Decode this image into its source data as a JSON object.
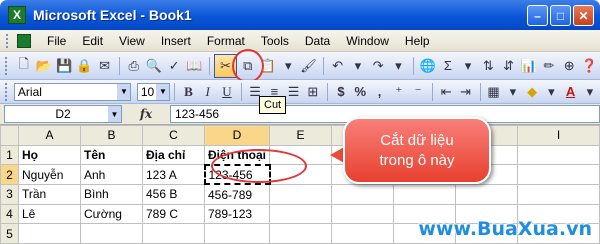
{
  "window": {
    "title": "Microsoft Excel - Book1",
    "app_icon_letter": "X",
    "buttons": {
      "minimize": "–",
      "maximize": "□",
      "close": "✕"
    }
  },
  "menu": {
    "items": [
      "File",
      "Edit",
      "View",
      "Insert",
      "Format",
      "Tools",
      "Data",
      "Window",
      "Help"
    ]
  },
  "toolbar": {
    "standard_icons": [
      "new-icon",
      "open-icon",
      "save-icon",
      "permission-icon",
      "email-icon",
      "print-icon",
      "print-preview-icon",
      "spelling-icon",
      "research-icon",
      "cut-icon",
      "copy-icon",
      "paste-icon",
      "format-painter-icon",
      "undo-icon",
      "redo-icon",
      "hyperlink-icon",
      "autosum-icon",
      "sort-ascending-icon",
      "sort-descending-icon",
      "chart-wizard-icon",
      "drawing-icon",
      "zoom-icon",
      "help-icon"
    ],
    "cut_tooltip": "Cut",
    "font_name": "Arial",
    "font_size": "10",
    "bold_label": "B",
    "italic_label": "I",
    "underline_label": "U",
    "currency_label": "$",
    "percent_label": "%",
    "comma_label": ",",
    "font_color_label": "A"
  },
  "formula_bar": {
    "name_box": "D2",
    "fx_label": "fx",
    "value": "123-456"
  },
  "sheet": {
    "columns": [
      "A",
      "B",
      "C",
      "D",
      "E",
      "F",
      "G",
      "H",
      "I"
    ],
    "rows": [
      {
        "num": "1",
        "cells": [
          "Họ",
          "Tên",
          "Địa chỉ",
          "Điện thoại",
          "",
          "",
          "",
          "",
          ""
        ]
      },
      {
        "num": "2",
        "cells": [
          "Nguyễn",
          "Anh",
          "123 A",
          "123-456",
          "",
          "",
          "",
          "",
          ""
        ]
      },
      {
        "num": "3",
        "cells": [
          "Trần",
          "Bình",
          "456 B",
          "456-789",
          "",
          "",
          "",
          "",
          ""
        ]
      },
      {
        "num": "4",
        "cells": [
          "Lê",
          "Cường",
          "789 C",
          "789-123",
          "",
          "",
          "",
          "",
          ""
        ]
      },
      {
        "num": "5",
        "cells": [
          "",
          "",
          "",
          "",
          "",
          "",
          "",
          "",
          ""
        ]
      }
    ],
    "active_cell": "D2"
  },
  "callout": {
    "line1": "Cắt dữ liệu",
    "line2": "trong ô này",
    "color": "#e8402f"
  },
  "watermark": "www.BuaXua.vn"
}
